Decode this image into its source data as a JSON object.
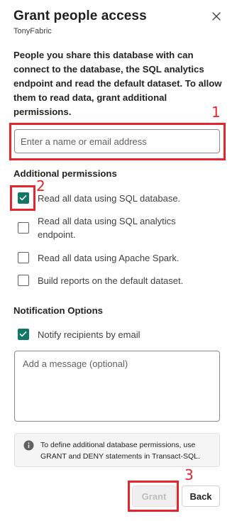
{
  "dialog": {
    "title": "Grant people access",
    "subtitle": "TonyFabric",
    "description": "People you share this database with can connect to the database, the SQL analytics endpoint and read the default dataset. To allow them to read data, grant additional permissions."
  },
  "people_input": {
    "placeholder": "Enter a name or email address",
    "value": ""
  },
  "permissions": {
    "heading": "Additional permissions",
    "items": [
      {
        "label": "Read all data using SQL database.",
        "checked": true
      },
      {
        "label": "Read all data using SQL analytics endpoint.",
        "checked": false
      },
      {
        "label": "Read all data using Apache Spark.",
        "checked": false
      },
      {
        "label": "Build reports on the default dataset.",
        "checked": false
      }
    ]
  },
  "notification": {
    "heading": "Notification Options",
    "notify_label": "Notify recipients by email",
    "notify_checked": true,
    "message_placeholder": "Add a message (optional)"
  },
  "info_text": "To define additional database permissions, use GRANT and DENY statements in Transact-SQL.",
  "buttons": {
    "grant": "Grant",
    "back": "Back"
  },
  "annotations": [
    "1",
    "2",
    "3"
  ],
  "colors": {
    "accent": "#117865",
    "annotation": "#e3262e"
  }
}
